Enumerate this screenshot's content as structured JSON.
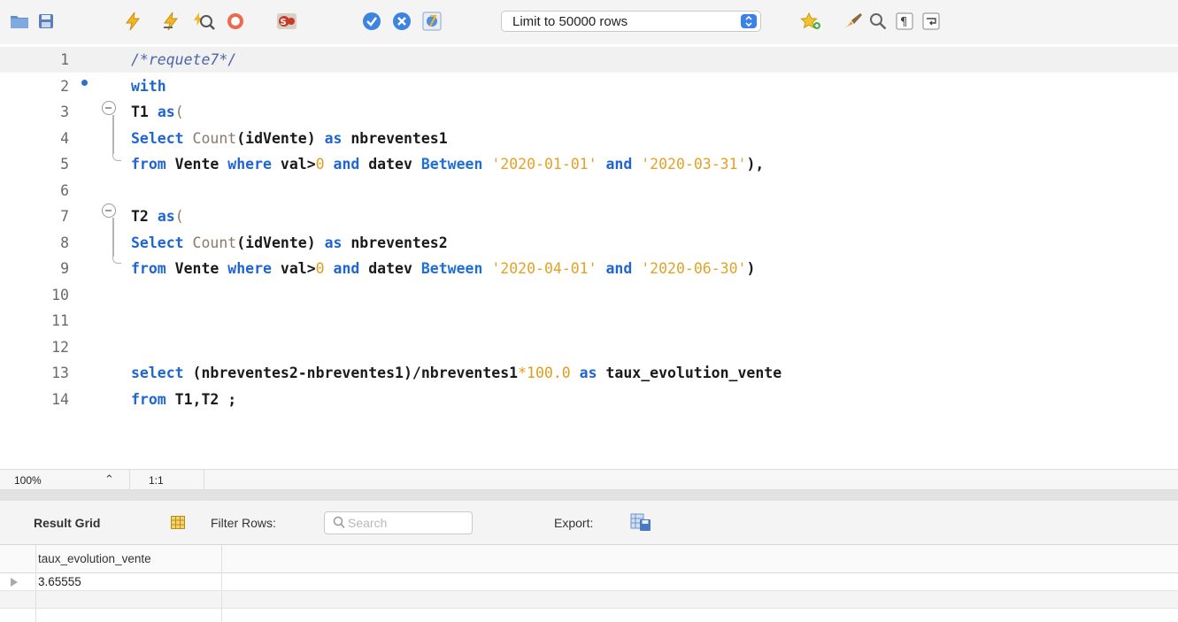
{
  "toolbar": {
    "limit_select_value": "Limit to 50000 rows",
    "icons": [
      "folder-icon",
      "save-icon",
      "execute-icon",
      "execute-current-icon",
      "explain-icon",
      "stop-icon",
      "stop-on-error-icon",
      "commit-icon",
      "rollback-icon",
      "autocommit-icon",
      "add-snippet-icon",
      "beautify-icon",
      "find-icon",
      "invisible-chars-icon",
      "word-wrap-icon"
    ]
  },
  "editor": {
    "lines": [
      {
        "n": "1",
        "parts": [
          {
            "t": "/*requete7*/",
            "c": "cm"
          }
        ]
      },
      {
        "n": "2",
        "parts": [
          {
            "t": "with",
            "c": "k"
          }
        ]
      },
      {
        "n": "3",
        "parts": [
          {
            "t": "T1 ",
            "c": "id"
          },
          {
            "t": "as",
            "c": "k"
          },
          {
            "t": "(",
            "c": "fn"
          }
        ]
      },
      {
        "n": "4",
        "parts": [
          {
            "t": "Select ",
            "c": "k"
          },
          {
            "t": "Count",
            "c": "fn"
          },
          {
            "t": "(idVente) ",
            "c": "id"
          },
          {
            "t": "as ",
            "c": "k"
          },
          {
            "t": "nbreventes1",
            "c": "id"
          }
        ]
      },
      {
        "n": "5",
        "parts": [
          {
            "t": "from ",
            "c": "k"
          },
          {
            "t": "Vente ",
            "c": "id"
          },
          {
            "t": "where ",
            "c": "k"
          },
          {
            "t": "val>",
            "c": "id"
          },
          {
            "t": "0",
            "c": "nm"
          },
          {
            "t": " and ",
            "c": "k"
          },
          {
            "t": "datev ",
            "c": "id"
          },
          {
            "t": "Between ",
            "c": "kb"
          },
          {
            "t": "'2020-01-01'",
            "c": "st"
          },
          {
            "t": " and ",
            "c": "k"
          },
          {
            "t": "'2020-03-31'",
            "c": "st"
          },
          {
            "t": "),",
            "c": "id"
          }
        ]
      },
      {
        "n": "6",
        "parts": []
      },
      {
        "n": "7",
        "parts": [
          {
            "t": "T2 ",
            "c": "id"
          },
          {
            "t": "as",
            "c": "k"
          },
          {
            "t": "(",
            "c": "fn"
          }
        ]
      },
      {
        "n": "8",
        "parts": [
          {
            "t": "Select ",
            "c": "k"
          },
          {
            "t": "Count",
            "c": "fn"
          },
          {
            "t": "(idVente) ",
            "c": "id"
          },
          {
            "t": "as ",
            "c": "k"
          },
          {
            "t": "nbreventes2",
            "c": "id"
          }
        ]
      },
      {
        "n": "9",
        "parts": [
          {
            "t": "from ",
            "c": "k"
          },
          {
            "t": "Vente ",
            "c": "id"
          },
          {
            "t": "where ",
            "c": "k"
          },
          {
            "t": "val>",
            "c": "id"
          },
          {
            "t": "0",
            "c": "nm"
          },
          {
            "t": " and ",
            "c": "k"
          },
          {
            "t": "datev ",
            "c": "id"
          },
          {
            "t": "Between ",
            "c": "kb"
          },
          {
            "t": "'2020-04-01'",
            "c": "st"
          },
          {
            "t": " and ",
            "c": "k"
          },
          {
            "t": "'2020-06-30'",
            "c": "st"
          },
          {
            "t": ")",
            "c": "id"
          }
        ]
      },
      {
        "n": "10",
        "parts": []
      },
      {
        "n": "11",
        "parts": []
      },
      {
        "n": "12",
        "parts": []
      },
      {
        "n": "13",
        "parts": [
          {
            "t": "select ",
            "c": "k"
          },
          {
            "t": "(nbreventes2-nbreventes1)/nbreventes1",
            "c": "id"
          },
          {
            "t": "*",
            "c": "nm"
          },
          {
            "t": "100.0",
            "c": "nm"
          },
          {
            "t": " as ",
            "c": "k"
          },
          {
            "t": "taux_evolution_vente",
            "c": "id"
          }
        ]
      },
      {
        "n": "14",
        "parts": [
          {
            "t": "from ",
            "c": "k"
          },
          {
            "t": "T1,T2 ;",
            "c": "id"
          }
        ]
      }
    ]
  },
  "status": {
    "zoom": "100%",
    "position": "1:1"
  },
  "result": {
    "tab_label": "Result Grid",
    "filter_label": "Filter Rows:",
    "search_placeholder": "Search",
    "export_label": "Export:",
    "columns": [
      "taux_evolution_vente"
    ],
    "rows": [
      [
        "3.65555"
      ]
    ]
  },
  "colors": {
    "keyword": "#1f66d1",
    "string": "#e5a127",
    "number": "#e09b1d",
    "comment": "#4d64a8",
    "accent": "#3b82e8"
  }
}
